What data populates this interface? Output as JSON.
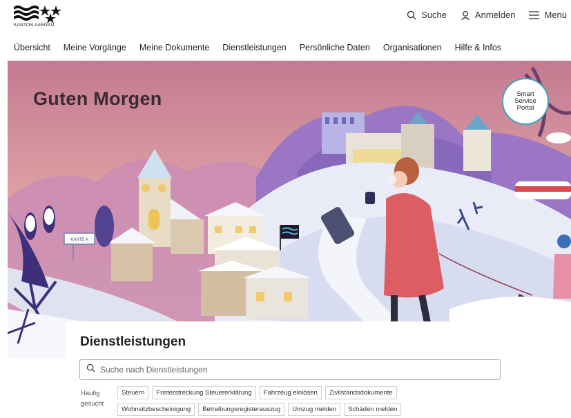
{
  "brand": {
    "logo_text": "KANTON AARGAU"
  },
  "header": {
    "search_label": "Suche",
    "login_label": "Anmelden",
    "menu_label": "Menü"
  },
  "nav": {
    "items": [
      {
        "label": "Übersicht"
      },
      {
        "label": "Meine Vorgänge"
      },
      {
        "label": "Meine Dokumente"
      },
      {
        "label": "Dienstleistungen"
      },
      {
        "label": "Persönliche Daten"
      },
      {
        "label": "Organisationen"
      },
      {
        "label": "Hilfe & Infos"
      }
    ]
  },
  "hero": {
    "greeting": "Guten Morgen",
    "badge_line1": "Smart",
    "badge_line2": "Service",
    "badge_line3": "Portal",
    "village_sign": "KANTE A"
  },
  "services": {
    "title": "Dienstleistungen",
    "search_placeholder": "Suche nach Dienstleistungen",
    "frequent_label": "Häufig gesucht",
    "chips": [
      "Steuern",
      "Fristerstreckung Steuererklärung",
      "Fahrzeug einlösen",
      "Zivilstandsdokumente",
      "Wohnsitzbescheinigung",
      "Betreibungsregisterauszug",
      "Umzug melden",
      "Schäden melden"
    ]
  },
  "colors": {
    "accent": "#3aa7b8",
    "sky_top": "#c67f92",
    "sky_bottom": "#e7b9b0",
    "hill_purple": "#8d6fb8",
    "coat_red": "#d9555b"
  }
}
